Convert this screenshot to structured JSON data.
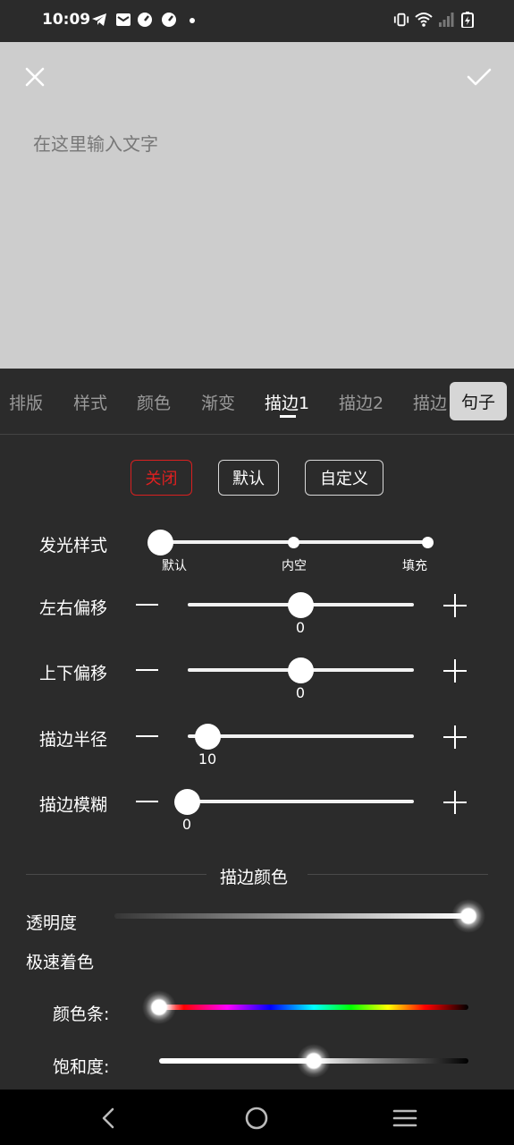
{
  "status_bar": {
    "time": "10:09",
    "left_icons": [
      "telegram-icon",
      "mail-icon",
      "speedometer-icon",
      "speedometer-icon",
      "dot-icon"
    ],
    "right_icons": [
      "vibrate-icon",
      "wifi-icon",
      "signal-icon",
      "battery-charging-icon"
    ]
  },
  "editor": {
    "close_icon": "close-icon",
    "confirm_icon": "check-icon",
    "placeholder": "在这里输入文字"
  },
  "tabs": {
    "items": [
      "排版",
      "样式",
      "颜色",
      "渐变",
      "描边1",
      "描边2",
      "描边"
    ],
    "active": "描边1",
    "sentence_button": "句子"
  },
  "mode_buttons": {
    "off": "关闭",
    "default": "默认",
    "custom": "自定义",
    "active": "关闭",
    "active_color": "#e02020"
  },
  "glow_style": {
    "label": "发光样式",
    "options": [
      "默认",
      "内空",
      "填充"
    ],
    "selected": "默认"
  },
  "sliders": {
    "offset_x": {
      "label": "左右偏移",
      "value": "0"
    },
    "offset_y": {
      "label": "上下偏移",
      "value": "0"
    },
    "radius": {
      "label": "描边半径",
      "value": "10"
    },
    "blur": {
      "label": "描边模糊",
      "value": "0"
    }
  },
  "stroke_color": {
    "section_title": "描边颜色",
    "opacity_label": "透明度",
    "opacity_value": 1.0,
    "quick_color_label": "极速着色",
    "hue_label": "颜色条:",
    "hue_value": 0,
    "saturation_label": "饱和度:",
    "saturation_value": 0.5
  },
  "navbar": {
    "back_icon": "back-icon",
    "home_icon": "home-icon",
    "menu_icon": "menu-icon"
  }
}
